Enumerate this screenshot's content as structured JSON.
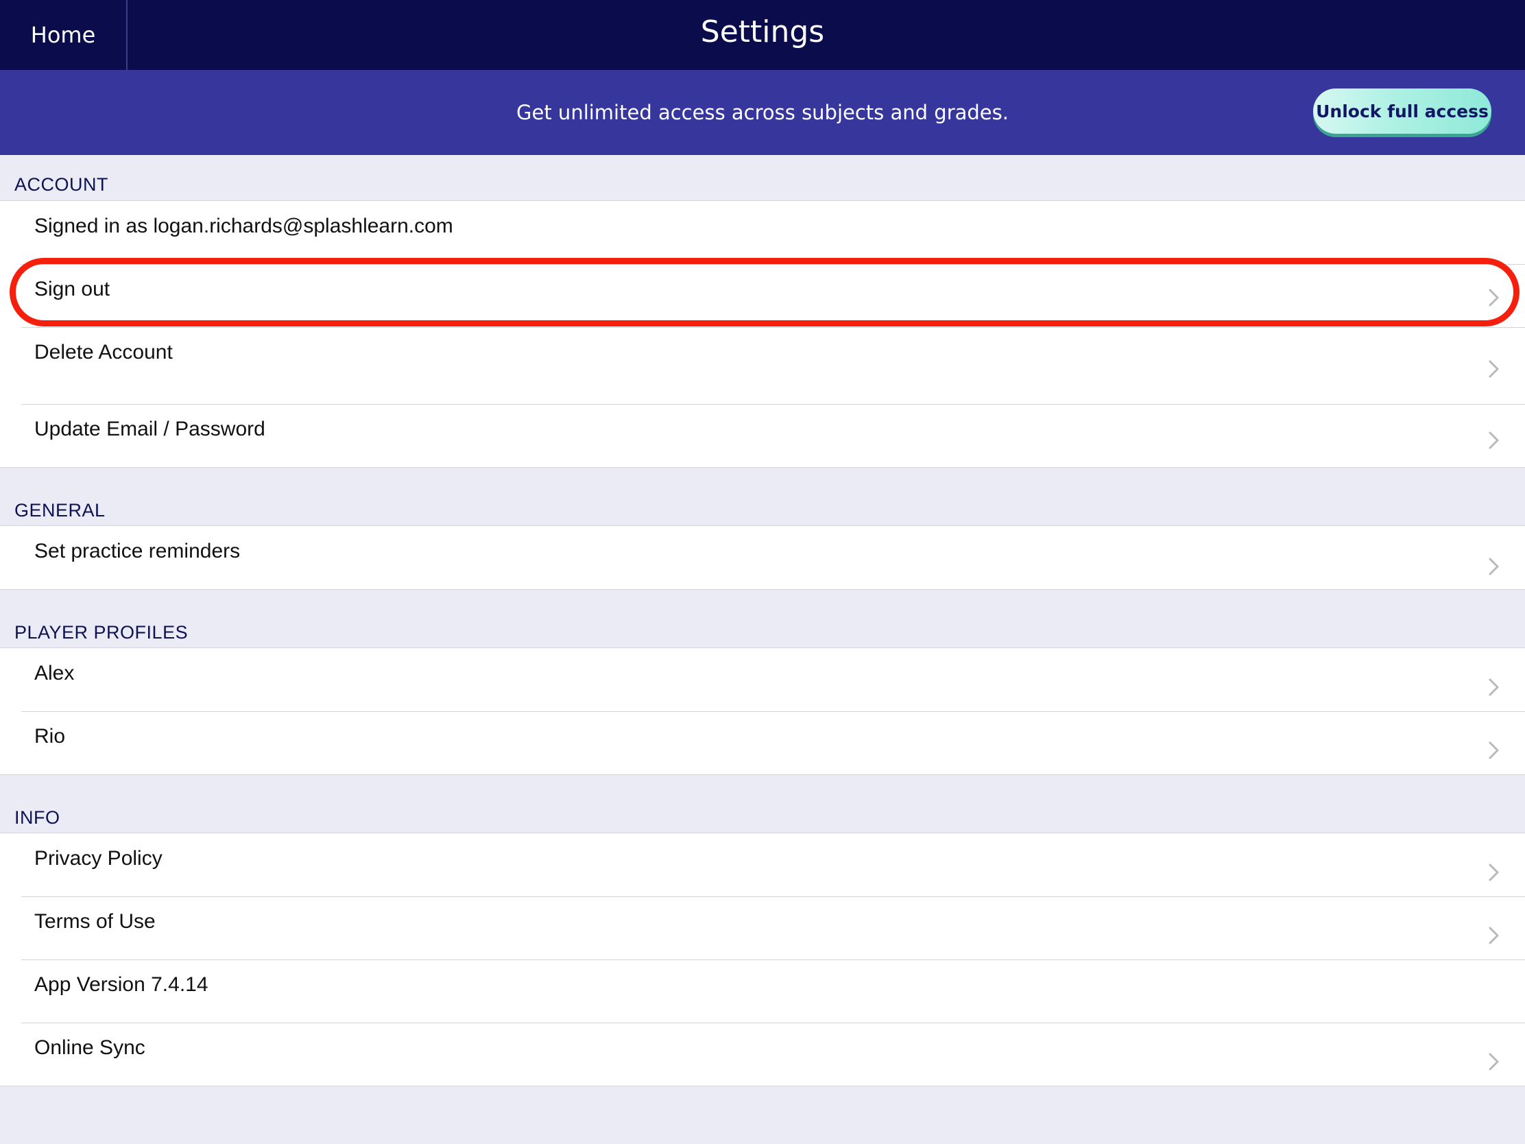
{
  "nav": {
    "home_label": "Home",
    "title": "Settings"
  },
  "banner": {
    "text": "Get unlimited access across subjects and grades.",
    "button_label": "Unlock full access"
  },
  "sections": {
    "account": {
      "header": "ACCOUNT",
      "signed_in": "Signed in as logan.richards@splashlearn.com",
      "sign_out": "Sign out",
      "delete_account": "Delete Account",
      "update_email_password": "Update Email / Password"
    },
    "general": {
      "header": "GENERAL",
      "practice_reminders": "Set practice reminders"
    },
    "player_profiles": {
      "header": "PLAYER PROFILES",
      "profiles": [
        "Alex",
        "Rio"
      ]
    },
    "info": {
      "header": "INFO",
      "privacy_policy": "Privacy Policy",
      "terms_of_use": "Terms of Use",
      "app_version": "App Version 7.4.14",
      "online_sync": "Online Sync"
    }
  },
  "icons": {
    "row_chevron": "chevron-right-icon"
  },
  "colors": {
    "navbar": "#0a0c4c",
    "banner": "#36369c",
    "unlock_button": "#aef1e4",
    "highlight": "#f41f0c",
    "page_background": "#ebebf6"
  }
}
